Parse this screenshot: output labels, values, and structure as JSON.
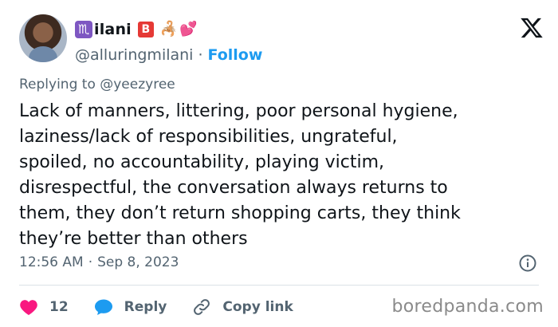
{
  "author": {
    "zodiac_symbol": "♏",
    "display_name": "ilani",
    "badge_letter": "B",
    "scorpion_emoji": "🦂",
    "hearts_emoji": "💕",
    "handle": "@alluringmilani",
    "separator": "·",
    "follow_label": "Follow"
  },
  "tweet": {
    "reply_prefix": "Replying to ",
    "reply_mention": "@yeezyree",
    "text": "Lack of manners, littering, poor personal hygiene,\nlaziness/lack of responsibilities, ungrateful,\nspoiled, no accountability, playing victim,\ndisrespectful, the conversation always returns to\nthem, they don’t return shopping carts, they think\nthey’re better than others",
    "time": "12:56 AM",
    "meta_separator": "·",
    "date": "Sep 8, 2023"
  },
  "actions": {
    "likes_count": "12",
    "reply_label": "Reply",
    "copy_link_label": "Copy link"
  },
  "watermark": "boredpanda.com",
  "colors": {
    "accent": "#1d9bf0",
    "like": "#f91880",
    "secondary_text": "#536471",
    "zodiac_badge": "#7e57c2",
    "b_badge": "#e53935"
  },
  "icons": [
    "x-logo-icon",
    "info-icon",
    "heart-icon",
    "reply-bubble-icon",
    "link-icon"
  ]
}
